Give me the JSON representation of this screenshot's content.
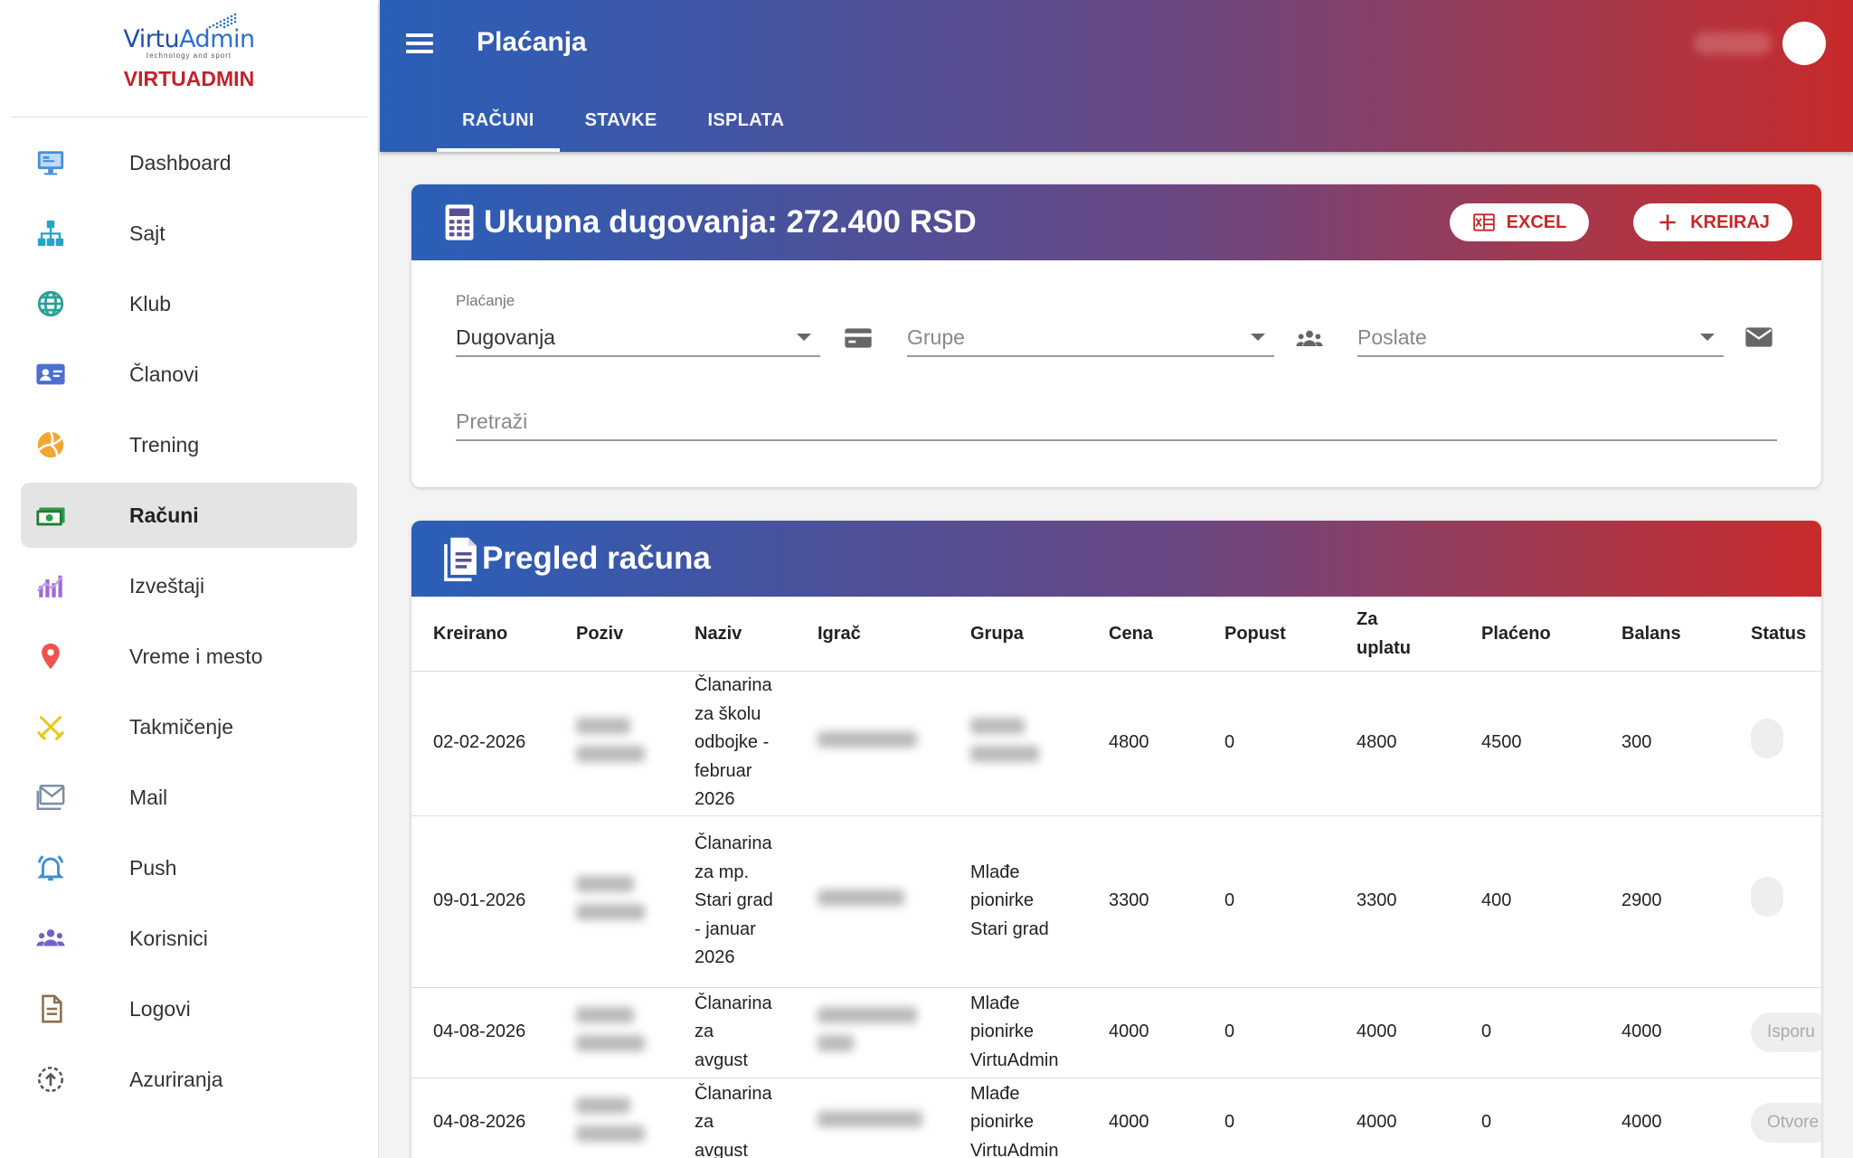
{
  "sidebar": {
    "logo_text_main": "Virtu",
    "logo_text_accent": "Admin",
    "logo_tagline": "technology and sport",
    "brand_name": "VIRTUADMIN",
    "items": [
      {
        "label": "Dashboard",
        "icon": "monitor-icon",
        "color": "#4a90d9"
      },
      {
        "label": "Sajt",
        "icon": "sitemap-icon",
        "color": "#26a3c9"
      },
      {
        "label": "Klub",
        "icon": "globe-icon",
        "color": "#2aa198"
      },
      {
        "label": "Članovi",
        "icon": "id-card-icon",
        "color": "#4c6fd0"
      },
      {
        "label": "Trening",
        "icon": "volleyball-icon",
        "color": "#f3a534"
      },
      {
        "label": "Računi",
        "icon": "money-icon",
        "color": "#2e9d4a"
      },
      {
        "label": "Izveštaji",
        "icon": "chart-icon",
        "color": "#9c6ad4"
      },
      {
        "label": "Vreme i mesto",
        "icon": "map-pin-icon",
        "color": "#ef5350"
      },
      {
        "label": "Takmičenje",
        "icon": "swords-icon",
        "color": "#e6c81f"
      },
      {
        "label": "Mail",
        "icon": "mail-icon",
        "color": "#7e8fa6"
      },
      {
        "label": "Push",
        "icon": "bell-icon",
        "color": "#3c8fd6"
      },
      {
        "label": "Korisnici",
        "icon": "users-icon",
        "color": "#7162c9"
      },
      {
        "label": "Logovi",
        "icon": "document-icon",
        "color": "#8d6e50"
      },
      {
        "label": "Azuriranja",
        "icon": "update-icon",
        "color": "#555555"
      }
    ],
    "active_index": 5
  },
  "header": {
    "title": "Plaćanja",
    "tabs": [
      {
        "label": "RAČUNI",
        "active": true
      },
      {
        "label": "STAVKE",
        "active": false
      },
      {
        "label": "ISPLATA",
        "active": false
      }
    ]
  },
  "summary_card": {
    "title": "Ukupna dugovanja: 272.400 RSD",
    "excel_label": "EXCEL",
    "create_label": "KREIRAJ",
    "filters": {
      "payment_label": "Plaćanje",
      "payment_value": "Dugovanja",
      "groups_placeholder": "Grupe",
      "sent_placeholder": "Poslate",
      "search_placeholder": "Pretraži"
    }
  },
  "invoices_card": {
    "title": "Pregled računa",
    "columns": [
      "Kreirano",
      "Poziv",
      "Naziv",
      "Igrač",
      "Grupa",
      "Cena",
      "Popust",
      "Za uplatu",
      "Plaćeno",
      "Balans",
      "Status"
    ],
    "rows": [
      {
        "created": "02-02-2026",
        "name": "Članarina za školu odbojke - februar 2026",
        "group": "",
        "price": "4800",
        "discount": "0",
        "to_pay": "4800",
        "paid": "4500",
        "balance": "300",
        "status": ""
      },
      {
        "created": "09-01-2026",
        "name": "Članarina za mp. Stari grad - januar 2026",
        "group": "Mlađe pionirke Stari grad",
        "price": "3300",
        "discount": "0",
        "to_pay": "3300",
        "paid": "400",
        "balance": "2900",
        "status": ""
      },
      {
        "created": "04-08-2026",
        "name": "Članarina za avgust",
        "group": "Mlađe pionirke VirtuAdmin",
        "price": "4000",
        "discount": "0",
        "to_pay": "4000",
        "paid": "0",
        "balance": "4000",
        "status": "Isporu"
      },
      {
        "created": "04-08-2026",
        "name": "Članarina za avgust",
        "group": "Mlađe pionirke VirtuAdmin",
        "price": "4000",
        "discount": "0",
        "to_pay": "4000",
        "paid": "0",
        "balance": "4000",
        "status": "Otvore"
      }
    ]
  },
  "colors": {
    "accent_red": "#c62828",
    "gradient_blue": "#2a5fb8",
    "gradient_red": "#c92a2c"
  }
}
